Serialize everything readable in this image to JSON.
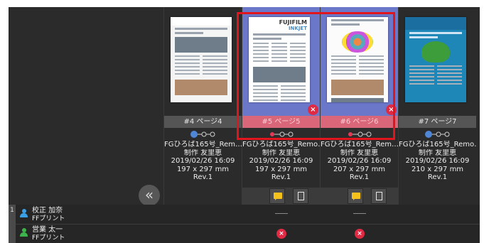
{
  "colors": {
    "background": "#2b2b2b",
    "selected_label": "#d96679",
    "selection_outline": "#e1161c",
    "badge_red": "#e02a43",
    "step_blue": "#4f87d6",
    "step_red": "#e23a55",
    "comment_yellow": "#f4c21a",
    "user_blue": "#3aa0e8",
    "user_green": "#3db44b"
  },
  "pages": [
    {
      "label": "#4 ページ4",
      "file": "FGひろば165号_Rem…",
      "author": "制作 友里恵",
      "datetime": "2019/02/26 16:09",
      "size": "197 x 297 mm",
      "revision": "Rev.1",
      "step_icon": "progress-steps-blue-icon"
    },
    {
      "label": "#5 ページ5",
      "file": "FGひろば165号_Remo…",
      "author": "制作 友里恵",
      "datetime": "2019/02/26 16:09",
      "size": "197 x 297 mm",
      "revision": "Rev.1",
      "step_icon": "progress-steps-red-icon",
      "thumb_brand": "FUJIFILM",
      "thumb_brand2": "INKJET"
    },
    {
      "label": "#6 ページ6",
      "file": "FGひろば165号_Rem…",
      "author": "制作 友里恵",
      "datetime": "2019/02/26 16:09",
      "size": "207 x 297 mm",
      "revision": "Rev.1",
      "step_icon": "progress-steps-red-icon"
    },
    {
      "label": "#7 ページ7",
      "file": "FGひろば165号_Remo…",
      "author": "制作 友里恵",
      "datetime": "2019/02/26 16:09",
      "size": "210 x 297 mm",
      "revision": "Rev.1",
      "step_icon": "progress-steps-blue-icon"
    }
  ],
  "collapse_symbol": "«",
  "reviewers": [
    {
      "row_number": "1",
      "name": "校正 加奈",
      "org": "FFプリント",
      "icon": "user-blue-icon"
    },
    {
      "name": "営業 太一",
      "org": "FFプリント",
      "icon": "user-green-icon"
    }
  ],
  "icons": {
    "delete": "×",
    "reject": "×",
    "comment": "comment-icon",
    "document": "document-icon"
  }
}
